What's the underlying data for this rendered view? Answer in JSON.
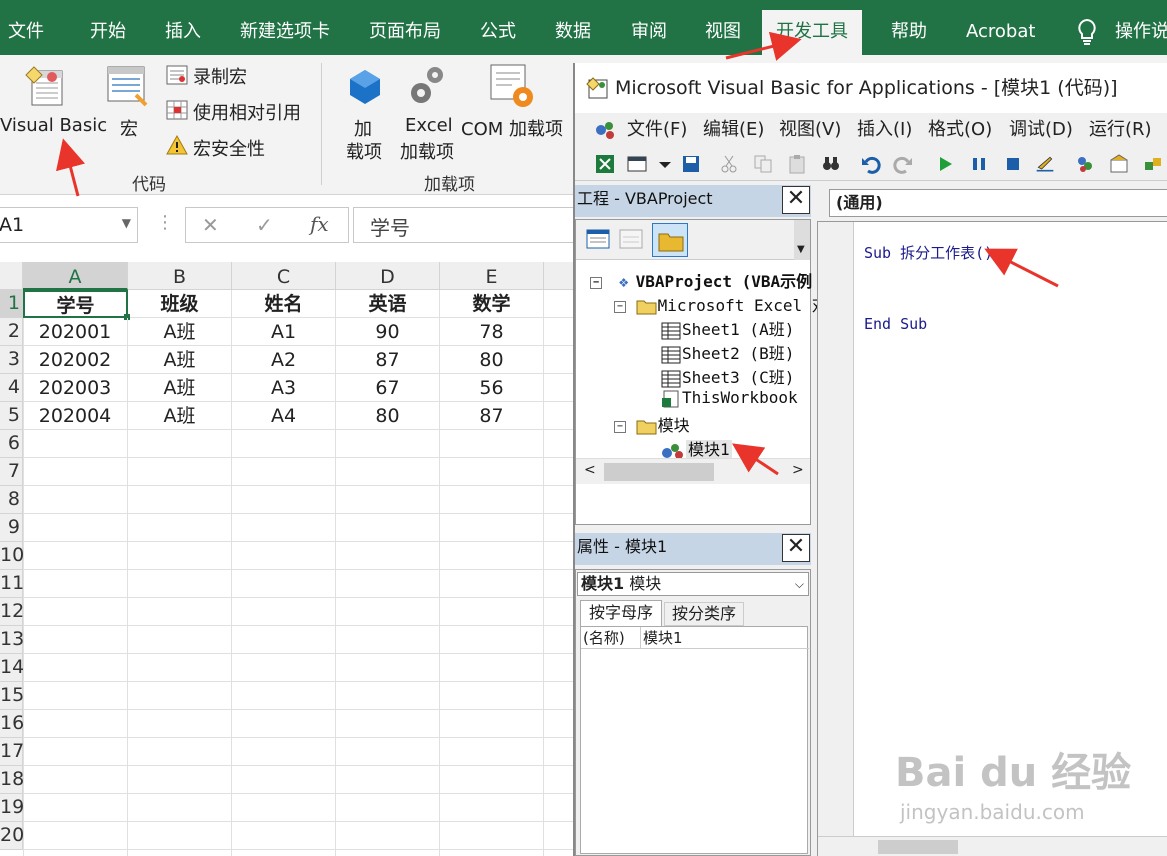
{
  "ribbon_tabs": [
    "文件",
    "开始",
    "插入",
    "新建选项卡",
    "页面布局",
    "公式",
    "数据",
    "审阅",
    "视图",
    "开发工具",
    "帮助",
    "Acrobat",
    "操作说"
  ],
  "ribbon": {
    "visual_basic": "Visual Basic",
    "macro": "宏",
    "record_macro": "录制宏",
    "relative_ref": "使用相对引用",
    "macro_security": "宏安全性",
    "group_code": "代码",
    "addin_line1": "加",
    "addin_line2": "载项",
    "excel_line1": "Excel",
    "excel_line2": "加载项",
    "com_addin": "COM 加载项",
    "group_addins": "加载项"
  },
  "formula_bar": {
    "name_box": "A1",
    "cancel": "✕",
    "enter": "✓",
    "fx": "fx",
    "content": "学号"
  },
  "sheet": {
    "columns": [
      "A",
      "B",
      "C",
      "D",
      "E"
    ],
    "row_numbers": [
      "1",
      "2",
      "3",
      "4",
      "5",
      "6",
      "7",
      "8",
      "9",
      "10",
      "11",
      "12",
      "13",
      "14",
      "15",
      "16",
      "17",
      "18",
      "19",
      "20"
    ],
    "headers": [
      "学号",
      "班级",
      "姓名",
      "英语",
      "数学"
    ],
    "rows": [
      [
        "202001",
        "A班",
        "A1",
        "90",
        "78"
      ],
      [
        "202002",
        "A班",
        "A2",
        "87",
        "80"
      ],
      [
        "202003",
        "A班",
        "A3",
        "67",
        "56"
      ],
      [
        "202004",
        "A班",
        "A4",
        "80",
        "87"
      ]
    ]
  },
  "vba": {
    "title": "Microsoft Visual Basic for Applications - [模块1 (代码)]",
    "menu": [
      "文件(F)",
      "编辑(E)",
      "视图(V)",
      "插入(I)",
      "格式(O)",
      "调试(D)",
      "运行(R)"
    ],
    "project_title": "工程 - VBAProject",
    "tree": {
      "root": "VBAProject (VBA示例",
      "excel_objects": "Microsoft Excel 对",
      "sheet1": "Sheet1 (A班)",
      "sheet2": "Sheet2 (B班)",
      "sheet3": "Sheet3 (C班)",
      "this_workbook": "ThisWorkbook",
      "modules": "模块",
      "module1": "模块1"
    },
    "properties_title": "属性 - 模块1",
    "prop_object": "模块1",
    "prop_object_type": "模块",
    "prop_tab_alpha": "按字母序",
    "prop_tab_cat": "按分类序",
    "prop_name_key": "(名称)",
    "prop_name_val": "模块1",
    "code_object": "(通用)",
    "code_line1": "Sub 拆分工作表()",
    "code_line2": "End Sub"
  },
  "watermark": {
    "logo": "Bai du 经验",
    "url": "jingyan.baidu.com"
  },
  "colors": {
    "excel_green": "#217346",
    "arrow_red": "#e8342a",
    "pane_title": "#c6d5e6",
    "code_blue": "#1a1a8c"
  }
}
